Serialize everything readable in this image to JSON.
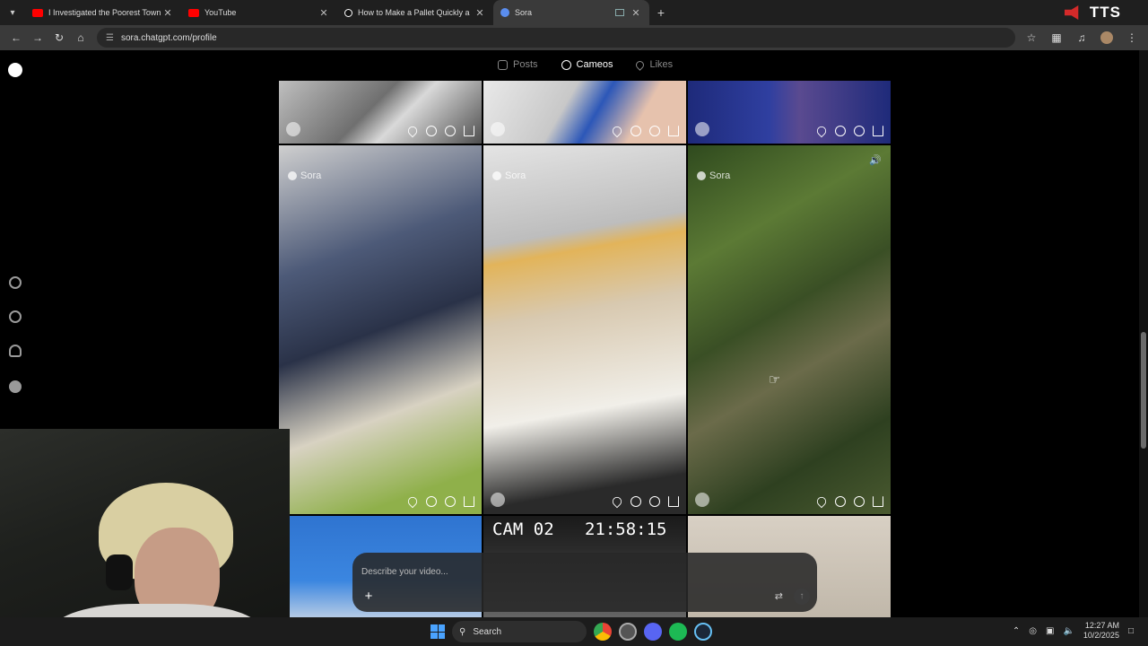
{
  "browser": {
    "tabs": [
      {
        "title": "I Investigated the Poorest Town",
        "icon": "youtube-icon",
        "active": false
      },
      {
        "title": "YouTube",
        "icon": "youtube-icon",
        "active": false
      },
      {
        "title": "How to Make a Pallet Quickly a",
        "icon": "tiktok-icon",
        "active": false
      },
      {
        "title": "Sora",
        "icon": "sora-icon",
        "active": true
      }
    ],
    "new_tab_symbol": "+",
    "tts_label": "TTS",
    "url": "sora.chatgpt.com/profile"
  },
  "profile_tabs": [
    {
      "label": "Posts",
      "active": false
    },
    {
      "label": "Cameos",
      "active": true
    },
    {
      "label": "Likes",
      "active": false
    }
  ],
  "grid": {
    "watermark": "Sora",
    "cam_overlay": "CAM 02   21:58:15"
  },
  "composer": {
    "placeholder": "Describe your video...",
    "plus_symbol": "+",
    "send_symbol": "↑"
  },
  "taskbar": {
    "search_label": "Search",
    "time": "12:27 AM",
    "date": "10/2/2025"
  }
}
